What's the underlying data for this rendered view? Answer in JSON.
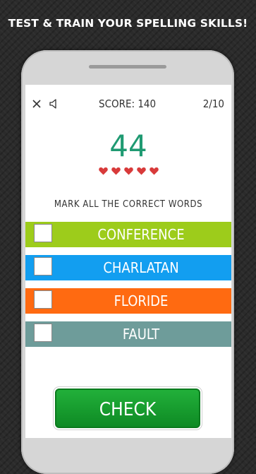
{
  "headline": "TEST & TRAIN YOUR SPELLING SKILLS!",
  "topbar": {
    "close_icon": "close-icon",
    "sound_icon": "speaker-icon",
    "score_text": "SCORE: 140",
    "progress_text": "2/10"
  },
  "timer": "44",
  "lives": 5,
  "instruction": "MARK ALL THE CORRECT WORDS",
  "words": [
    {
      "label": "CONFERENCE",
      "color": "#9dcc1b"
    },
    {
      "label": "CHARLATAN",
      "color": "#129ef0"
    },
    {
      "label": "FLORIDE",
      "color": "#ff6a11"
    },
    {
      "label": "FAULT",
      "color": "#6e9c9a"
    }
  ],
  "check_button": "CHECK",
  "colors": {
    "timer": "#1f9a72",
    "heart": "#d83a3a",
    "check_button": "#16a02f"
  }
}
